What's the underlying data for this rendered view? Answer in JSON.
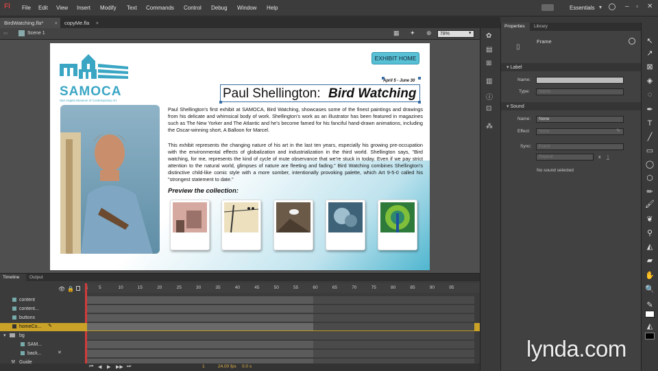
{
  "app": {
    "logo": "Fl",
    "menu": [
      "File",
      "Edit",
      "View",
      "Insert",
      "Modify",
      "Text",
      "Commands",
      "Control",
      "Debug",
      "Window",
      "Help"
    ],
    "workspace": "Essentials"
  },
  "doc_tabs": [
    {
      "label": "BirdWatching.fla*"
    },
    {
      "label": "copyMe.fla"
    }
  ],
  "editbar": {
    "scene": "Scene 1",
    "zoom": "78%"
  },
  "stage": {
    "exhibit_home": "EXHIBIT HOME",
    "logo_text": "SAMOCA",
    "logo_sub": "San Angelo Museum of Contemporary Art",
    "dates": "April 5 - June 30",
    "title_plain": "Paul Shellington: ",
    "title_italic": "Bird Watching",
    "para1": "Paul Shellington's first exhibit at SAMOCA, Bird Watching, showcases some of the finest paintings and drawings from his delicate and whimsical body of work. Shellington's work as an illustrator has been featured in magazines such as The New Yorker and The Atlantic and he's become famed for his fanciful hand-drawn animations, including the Oscar-winning short, A Balloon for Marcel.",
    "para2": "This exhibit represents the changing nature of his art in the last ten years, especially his growing pre-occupation with the environmental effects of globalization and industrialization in the third world. Shellington says, \"Bird watching, for me, represents the kind of cycle of mute observance that we're stuck in today. Even if we pay strict attention to the natural world, glimpses of nature are fleeting and fading.\" Bird Watching combines Shellington's distinctive child-like comic style with a more somber, intentionally provoking palette, which Art 9-5-0 called his \"strongest statement to date.\"",
    "preview_heading": "Preview the collection:"
  },
  "timeline": {
    "tabs": [
      "Timeline",
      "Output"
    ],
    "frame_numbers": [
      "1",
      "5",
      "10",
      "15",
      "20",
      "25",
      "30",
      "35",
      "40",
      "45",
      "50",
      "55",
      "60",
      "65",
      "70",
      "75",
      "80",
      "85",
      "90",
      "95"
    ],
    "layers": [
      {
        "name": "content"
      },
      {
        "name": "content..."
      },
      {
        "name": "buttons"
      },
      {
        "name": "homeCo..."
      },
      {
        "name": "bg"
      },
      {
        "name": "SAM..."
      },
      {
        "name": "back..."
      },
      {
        "name": "Guide"
      }
    ],
    "status": {
      "frame": "1",
      "fps": "24.00 fps",
      "time": "0.0 s"
    }
  },
  "properties": {
    "tabs": [
      "Properties",
      "Library"
    ],
    "object_type": "Frame",
    "label_section": "Label",
    "label_name_lbl": "Name:",
    "label_type_lbl": "Type:",
    "label_type_val": "Name",
    "sound_section": "Sound",
    "sound_name_lbl": "Name:",
    "sound_name_val": "None",
    "effect_lbl": "Effect:",
    "effect_val": "None",
    "sync_lbl": "Sync:",
    "sync_val": "Event",
    "repeat_val": "Repeat",
    "repeat_x": "x",
    "repeat_count": "1",
    "no_sound": "No sound selected"
  },
  "watermark": "lynda.com",
  "colors": {
    "accent_teal": "#4db8cf",
    "selection_blue": "#3a6ea5",
    "highlight_layer": "#c9a227"
  }
}
